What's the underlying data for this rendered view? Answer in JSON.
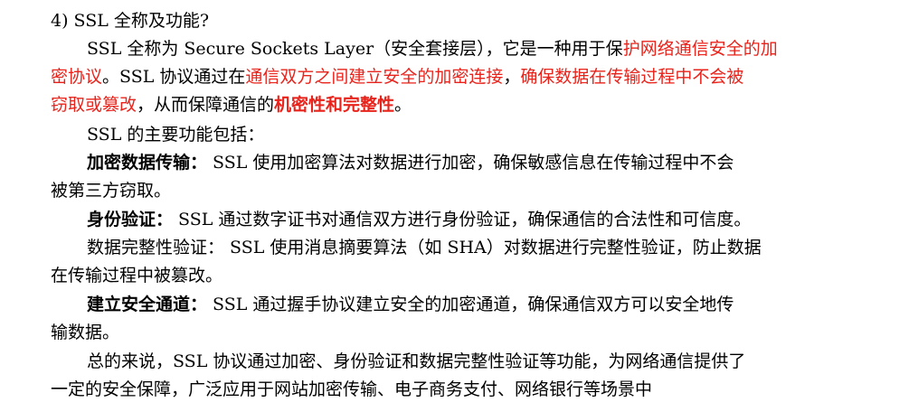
{
  "heading": "4)  SSL 全称及功能?",
  "intro": {
    "l1_a": "SSL 全称为 Secure Sockets Layer（安全套接层），它是一种用于保",
    "l1_red": "护网络通信安全的加",
    "l2_red_a": "密协议",
    "l2_b": "。SSL 协议通过在",
    "l2_red_b": "通信双方之间建立安全的加密连接",
    "l2_c": "，",
    "l2_red_c": "确保数据在传输过程中不会被",
    "l3_red_a": "窃取或篡改",
    "l3_b": "，从而保障通信的",
    "l3_red_bold": "机密性和完整性",
    "l3_c": "。"
  },
  "functions_intro": "SSL 的主要功能包括：",
  "functions": [
    {
      "title": "加密数据传输：",
      "line1": " SSL 使用加密算法对数据进行加密，确保敏感信息在传输过程中不会",
      "line2": "被第三方窃取。"
    },
    {
      "title": "身份验证：",
      "line1": " SSL 通过数字证书对通信双方进行身份验证，确保通信的合法性和可信度。"
    },
    {
      "title": "数据完整性验证：",
      "line1": " SSL 使用消息摘要算法（如 SHA）对数据进行完整性验证，防止数据",
      "line2": "在传输过程中被篡改。"
    },
    {
      "title": "建立安全通道：",
      "line1": " SSL 通过握手协议建立安全的加密通道，确保通信双方可以安全地传",
      "line2": "输数据。"
    }
  ],
  "summary": {
    "line1": "总的来说，SSL 协议通过加密、身份验证和数据完整性验证等功能，为网络通信提供了",
    "line2": "一定的安全保障，广泛应用于网站加密传输、电子商务支付、网络银行等场景中"
  },
  "colors": {
    "highlight": "#e8231b",
    "text": "#000000"
  }
}
